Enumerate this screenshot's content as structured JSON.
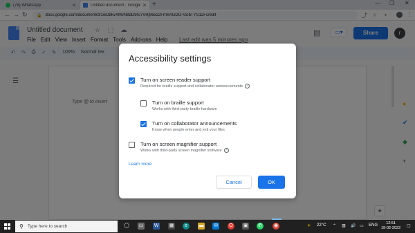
{
  "browser": {
    "tabs": [
      {
        "label": "(78) WhatsApp",
        "favicon_color": "#25d366"
      },
      {
        "label": "Untitled document - Google Do",
        "favicon_color": "#4285f4"
      }
    ],
    "new_tab": "+",
    "url": "docs.google.com/document/d/1wD8kvXMvN8dD9lS7VHj96x22FrImAGDO-VDbTYS12Fc/edit"
  },
  "docs": {
    "title": "Untitled document",
    "menu": [
      "File",
      "Edit",
      "View",
      "Insert",
      "Format",
      "Tools",
      "Add-ons",
      "Help"
    ],
    "last_edit": "Last edit was 5 minutes ago",
    "share_label": "Share",
    "avatar_letter": "r",
    "toolbar": {
      "zoom": "100%",
      "style": "Normal tex"
    },
    "placeholder": "Type @ to insert"
  },
  "dialog": {
    "title": "Accessibility settings",
    "options": [
      {
        "label": "Turn on screen reader support",
        "sub": "Required for braille support and collaborator announcements",
        "checked": true,
        "help": true
      },
      {
        "label": "Turn on braille support",
        "sub": "Works with third-party braille hardware",
        "checked": false
      },
      {
        "label": "Turn on collaborator announcements",
        "sub": "Know when people enter and exit your files",
        "checked": true
      },
      {
        "label": "Turn on screen magnifier support",
        "sub": "Works with third-party screen magnifier software",
        "checked": false,
        "help": true
      }
    ],
    "learn_more": "Learn more",
    "cancel_label": "Cancel",
    "ok_label": "OK"
  },
  "taskbar": {
    "search_placeholder": "Type here to search",
    "weather": "22°C",
    "lang": "ENG",
    "time": "12:51",
    "date": "19-02-2022"
  }
}
